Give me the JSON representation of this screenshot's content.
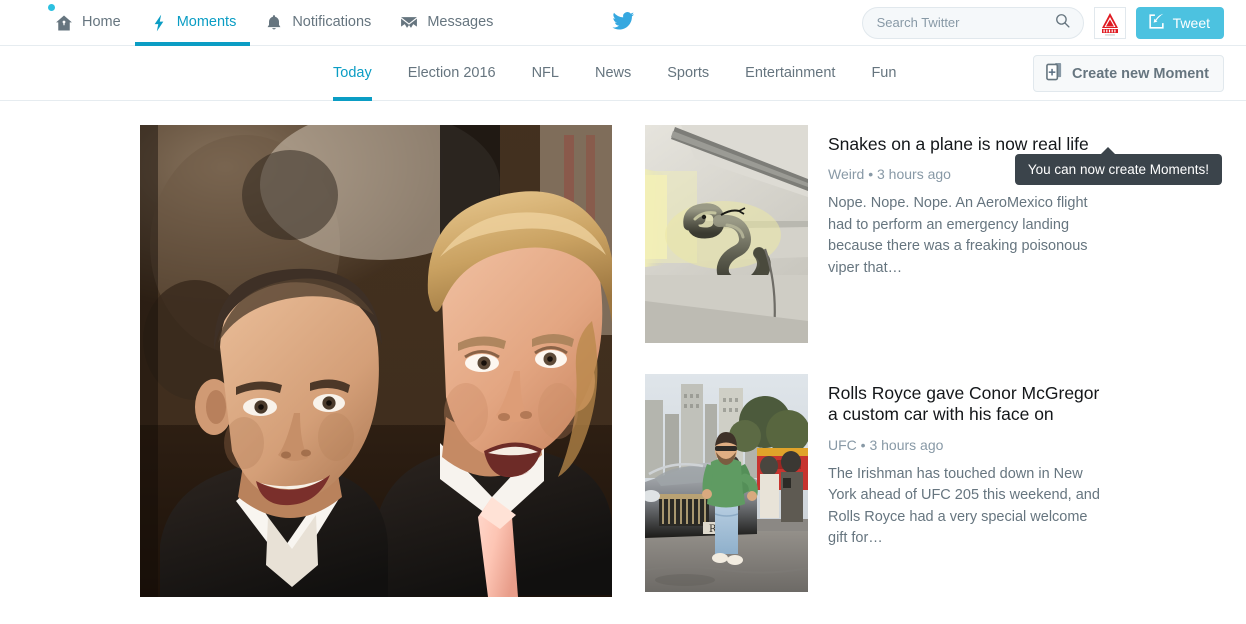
{
  "topnav": {
    "items": [
      {
        "label": "Home",
        "icon": "home-icon",
        "active": false,
        "badge_dot": true
      },
      {
        "label": "Moments",
        "icon": "lightning-bolt-icon",
        "active": true,
        "badge_dot": false
      },
      {
        "label": "Notifications",
        "icon": "bell-icon",
        "active": false,
        "badge_dot": false
      },
      {
        "label": "Messages",
        "icon": "envelope-icon",
        "active": false,
        "badge_dot": false
      }
    ],
    "logo": "twitter-bird-icon",
    "search": {
      "placeholder": "Search Twitter",
      "value": "",
      "icon": "search-icon"
    },
    "avatar": "profile-avatar",
    "tweet_button": {
      "label": "Tweet",
      "icon": "quill-compose-icon"
    }
  },
  "categories": {
    "items": [
      {
        "label": "Today",
        "active": true
      },
      {
        "label": "Election 2016",
        "active": false
      },
      {
        "label": "NFL",
        "active": false
      },
      {
        "label": "News",
        "active": false
      },
      {
        "label": "Sports",
        "active": false
      },
      {
        "label": "Entertainment",
        "active": false
      },
      {
        "label": "Fun",
        "active": false
      }
    ],
    "create_moment": {
      "label": "Create new Moment",
      "icon": "new-moment-icon"
    }
  },
  "tooltip": {
    "text": "You can now create Moments!"
  },
  "hero": {
    "alt": "Tom Brady and Donald Trump at an event"
  },
  "stories": [
    {
      "title": "Snakes on a plane is now real life",
      "category": "Weird",
      "time": "3 hours ago",
      "separator": "•",
      "description": "Nope. Nope. Nope. An AeroMexico flight had to perform an emergency landing because there was a freaking poisonous viper that…",
      "thumb_alt": "Snake coiled on overhead aircraft luggage bin"
    },
    {
      "title": "Rolls Royce gave Conor McGregor a custom car with his face on",
      "category": "UFC",
      "time": "3 hours ago",
      "separator": "•",
      "description": "The Irishman has touched down in New York ahead of UFC 205 this weekend, and Rolls Royce had a very special welcome gift for…",
      "thumb_alt": "Conor McGregor standing beside a Rolls Royce on a New York street"
    }
  ],
  "colors": {
    "accent": "#0b9dc4",
    "tweet_button": "#4cc2e0",
    "muted_text": "#66757f",
    "title_text": "#14171a",
    "tooltip_bg": "#3b444b",
    "border": "#e6ecf0"
  }
}
